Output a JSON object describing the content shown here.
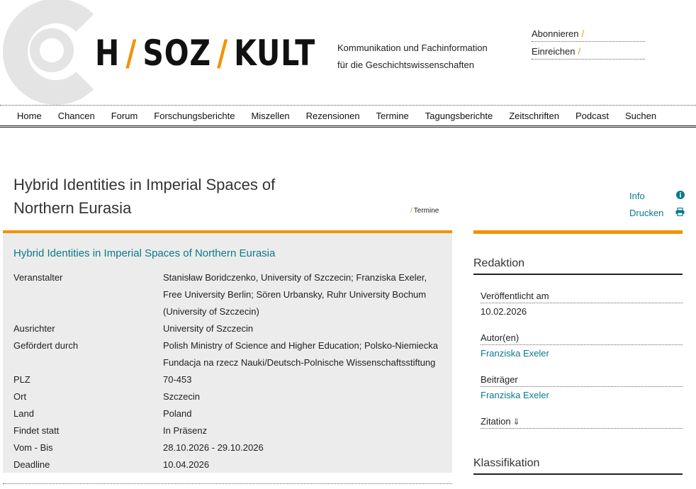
{
  "brand": {
    "logo_parts": [
      "H",
      "SOZ",
      "KULT"
    ],
    "tagline_line1": "Kommunikation und Fachinformation",
    "tagline_line2": "für die Geschichtswissenschaften",
    "accent_color": "#f39200",
    "link_color": "#0b7a8a"
  },
  "top_links": [
    {
      "label": "Abonnieren"
    },
    {
      "label": "Einreichen"
    }
  ],
  "nav": [
    {
      "label": "Home"
    },
    {
      "label": "Chancen"
    },
    {
      "label": "Forum"
    },
    {
      "label": "Forschungsberichte"
    },
    {
      "label": "Miszellen"
    },
    {
      "label": "Rezensionen"
    },
    {
      "label": "Termine"
    },
    {
      "label": "Tagungsberichte"
    },
    {
      "label": "Zeitschriften"
    },
    {
      "label": "Podcast"
    },
    {
      "label": "Suchen"
    }
  ],
  "page": {
    "title": "Hybrid Identities in Imperial Spaces of Northern Eurasia",
    "breadcrumb": "Termine"
  },
  "side_actions": [
    {
      "label": "Info",
      "icon": "info-circle-icon"
    },
    {
      "label": "Drucken",
      "icon": "print-icon"
    }
  ],
  "event": {
    "link_title": "Hybrid Identities in Imperial Spaces of Northern Eurasia",
    "facts": [
      {
        "key": "Veranstalter",
        "value": "Stanisław Boridczenko, University of Szczecin; Franziska Exeler, Free University Berlin; Sören Urbansky, Ruhr University Bochum (University of Szczecin)"
      },
      {
        "key": "Ausrichter",
        "value": "University of Szczecin"
      },
      {
        "key": "Gefördert durch",
        "value": "Polish Ministry of Science and Higher Education; Polsko-Niemiecka Fundacja na rzecz Nauki/Deutsch-Polnische Wissenschaftsstiftung"
      },
      {
        "key": "PLZ",
        "value": "70-453"
      },
      {
        "key": "Ort",
        "value": "Szczecin"
      },
      {
        "key": "Land",
        "value": "Poland"
      },
      {
        "key": "Findet statt",
        "value": "In Präsenz"
      },
      {
        "key": "Vom - Bis",
        "value": "28.10.2026 - 29.10.2026"
      },
      {
        "key": "Deadline",
        "value": "10.04.2026"
      }
    ]
  },
  "sidebar": {
    "redaktion_heading": "Redaktion",
    "published_label": "Veröffentlicht am",
    "published_value": "10.02.2026",
    "author_label": "Autor(en)",
    "author_value": "Franziska Exeler",
    "contributor_label": "Beiträger",
    "contributor_value": "Franziska Exeler",
    "citation_label": "Zitation",
    "classification_heading": "Klassifikation"
  }
}
